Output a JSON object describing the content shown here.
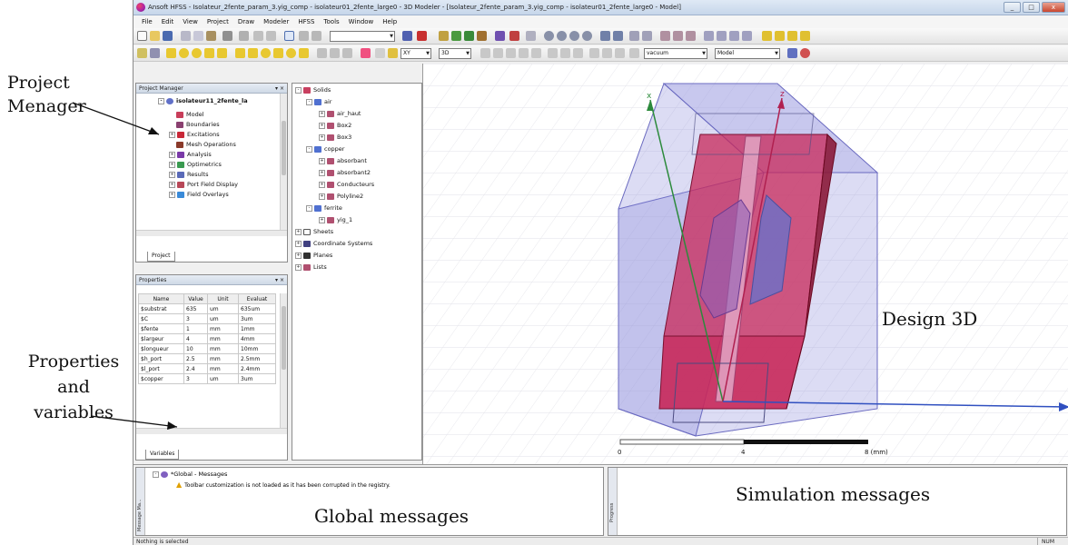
{
  "window": {
    "title": "Ansoft HFSS - Isolateur_2fente_param_3.yig_comp - isolateur01_2fente_large0 - 3D Modeler - [Isolateur_2fente_param_3.yig_comp - isolateur01_2fente_large0 - Model]",
    "buttons": [
      "_",
      "□",
      "x"
    ]
  },
  "menu": [
    "File",
    "Edit",
    "View",
    "Project",
    "Draw",
    "Modeler",
    "HFSS",
    "Tools",
    "Window",
    "Help"
  ],
  "toolbar": {
    "plane_select": "XY",
    "view_select": "3D",
    "material_select": "vacuum",
    "mode_select": "Model"
  },
  "annotations": {
    "project_manager": [
      "Project",
      "Menager"
    ],
    "properties": [
      "Properties",
      "and",
      "variables"
    ],
    "design3d": "Design 3D",
    "global_messages": "Global messages",
    "simulation_messages": "Simulation messages"
  },
  "project_manager": {
    "header": "Project Manager",
    "tab": "Project",
    "root": "isolateur11_2fente_la",
    "items": [
      "Model",
      "Boundaries",
      "Excitations",
      "Mesh Operations",
      "Analysis",
      "Optimetrics",
      "Results",
      "Port Field Display",
      "Field Overlays"
    ]
  },
  "properties": {
    "header": "Properties",
    "tab": "Variables",
    "columns": [
      "Name",
      "Value",
      "Unit",
      "Evaluat"
    ],
    "rows": [
      [
        "$substrat",
        "635",
        "um",
        "635um"
      ],
      [
        "$C",
        "3",
        "um",
        "3um"
      ],
      [
        "$fente",
        "1",
        "mm",
        "1mm"
      ],
      [
        "$largeur",
        "4",
        "mm",
        "4mm"
      ],
      [
        "$longueur",
        "10",
        "mm",
        "10mm"
      ],
      [
        "$h_port",
        "2.5",
        "mm",
        "2.5mm"
      ],
      [
        "$l_port",
        "2.4",
        "mm",
        "2.4mm"
      ],
      [
        "$copper",
        "3",
        "um",
        "3um"
      ]
    ]
  },
  "model_tree": {
    "solids": "Solids",
    "groups": [
      {
        "name": "air",
        "children": [
          "air_haut",
          "Box2",
          "Box3"
        ]
      },
      {
        "name": "copper",
        "children": [
          "absorbant",
          "absorbant2",
          "Conducteurs",
          "Polyline2"
        ]
      },
      {
        "name": "ferrite",
        "children": [
          "yig_1"
        ]
      }
    ],
    "others": [
      "Sheets",
      "Coordinate Systems",
      "Planes",
      "Lists"
    ]
  },
  "viewport": {
    "axes": [
      "x",
      "z"
    ],
    "scale_labels": [
      "0",
      "4",
      "8 (mm)"
    ]
  },
  "messages": {
    "side_label": "Message Ma...",
    "root": "*Global - Messages",
    "warning": "Toolbar customization is not loaded as it has been corrupted in the registry.",
    "progress_label": "Progress"
  },
  "status": {
    "left": "Nothing is selected",
    "num": "NUM"
  },
  "colors": {
    "ferrite": "#c8285a",
    "air_box": "#8a8ad8",
    "axis_x": "#2c8a3c",
    "axis_z": "#b02050",
    "axis_y": "#3050c0"
  }
}
